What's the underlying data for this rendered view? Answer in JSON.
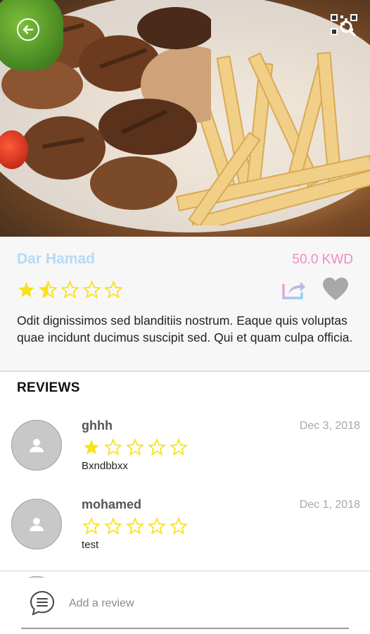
{
  "restaurant": {
    "name": "Dar Hamad",
    "price": "50.0 KWD",
    "rating": 1.5,
    "rating_max": 5,
    "description": "Odit dignissimos sed blanditiis nostrum. Eaque quis voluptas quae incidunt ducimus suscipit sed. Qui et quam culpa officia."
  },
  "reviews": {
    "title": "REVIEWS",
    "items": [
      {
        "name": "ghhh",
        "date": "Dec 3, 2018",
        "rating": 1,
        "text": "Bxndbbxx"
      },
      {
        "name": "mohamed",
        "date": "Dec 1, 2018",
        "rating": 0,
        "text": "test"
      }
    ]
  },
  "composer": {
    "placeholder": "Add a review"
  },
  "colors": {
    "name": "#b5daf5",
    "price": "#f08cc0",
    "star": "#f7e21b",
    "icon_gray": "#a8a8a8"
  },
  "icons": [
    "back-arrow-icon",
    "qr-code-icon",
    "share-icon",
    "heart-icon",
    "user-icon",
    "chat-icon"
  ]
}
